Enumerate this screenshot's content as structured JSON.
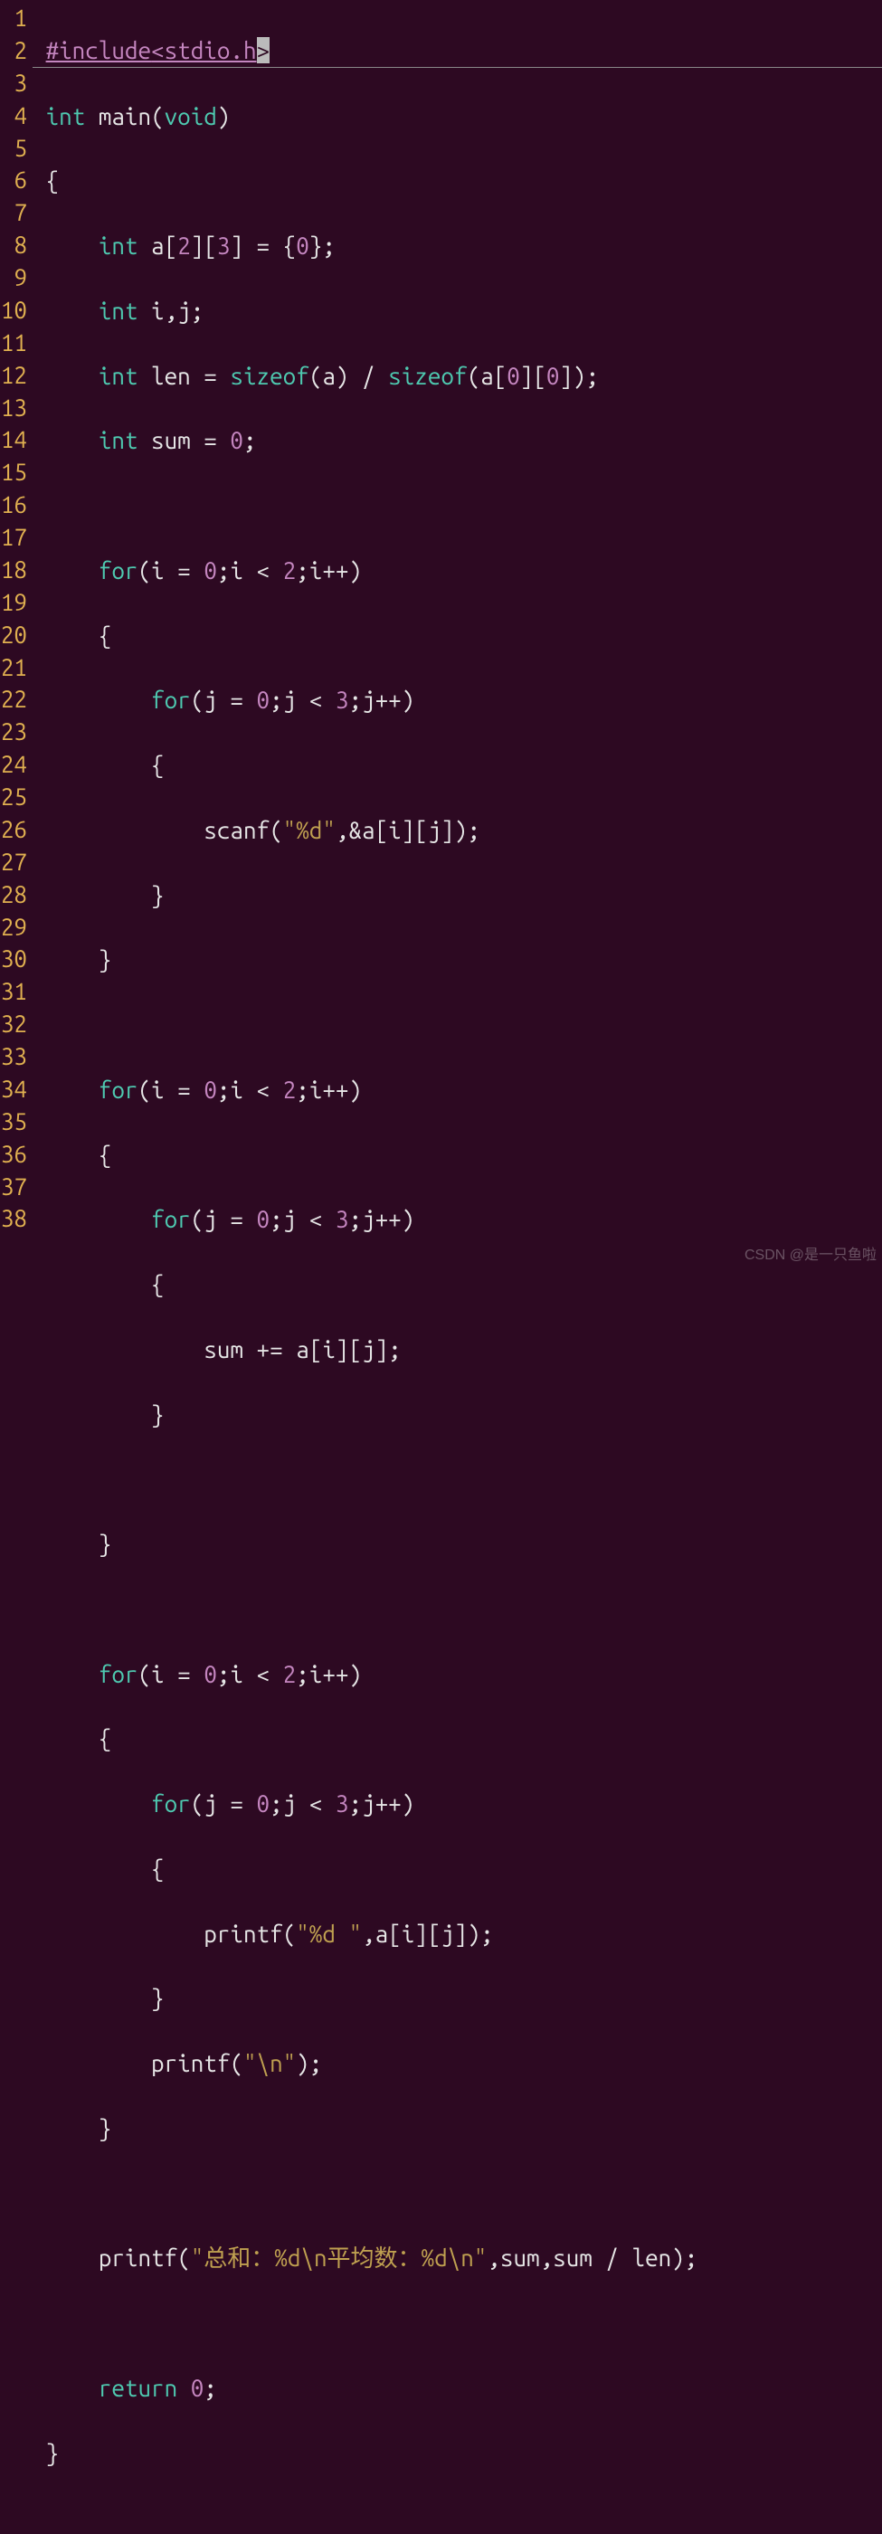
{
  "watermark": "CSDN @是一只鱼啦",
  "gutter": [
    "1",
    "2",
    "3",
    "4",
    "5",
    "6",
    "7",
    "8",
    "9",
    "10",
    "11",
    "12",
    "13",
    "14",
    "15",
    "16",
    "17",
    "18",
    "19",
    "20",
    "21",
    "22",
    "23",
    "24",
    "25",
    "26",
    "27",
    "28",
    "29",
    "30",
    "31",
    "32",
    "33",
    "34",
    "35",
    "36",
    "37",
    "38"
  ],
  "tokens": {
    "include": "#include",
    "hdr": "<stdio.h",
    "hdr_end": ">",
    "int": "int",
    "main": " main(",
    "void": "void",
    "rp_brace": ")",
    "lbrace": "{",
    "rbrace": "}",
    "decl_a1": "    ",
    "decl_a2": " a[",
    "n2": "2",
    "rb": "][",
    "n3": "3",
    "decl_a3": "] = {",
    "n0": "0",
    "decl_a4": "};",
    "decl_ij": "    ",
    "ij": " i,j;",
    "len1": "    ",
    "len": " len = ",
    "sizeof": "sizeof",
    "len2": "(a) / ",
    "len3": "(a[",
    "len4": "][",
    "len5": "]);",
    "sum1": "    ",
    "sum2": " sum = ",
    "sc": ";",
    "for": "for",
    "for_open": "(i = ",
    "for_mid": ";i < ",
    "for_end": ";i++)",
    "for_open_j": "(j = ",
    "for_mid_j": ";j < ",
    "for_end_j": ";j++)",
    "ind1": "    ",
    "ind2": "        ",
    "ind3": "            ",
    "scanf": "scanf(",
    "fmt_d": "\"%d\"",
    "scanf2": ",&a[i][j]);",
    "sum_line": "sum += a[i][j];",
    "printf": "printf(",
    "fmt_ds": "\"%d \"",
    "printf2": ",a[i][j]);",
    "fmt_nl": "\"\\n\"",
    "printf_nl": ");",
    "final1": "printf(",
    "final_str": "\"总和：%d\\n平均数：%d\\n\"",
    "final2": ",sum,sum / len);",
    "return": "return",
    "ret2": " ",
    "ret3": ";"
  }
}
